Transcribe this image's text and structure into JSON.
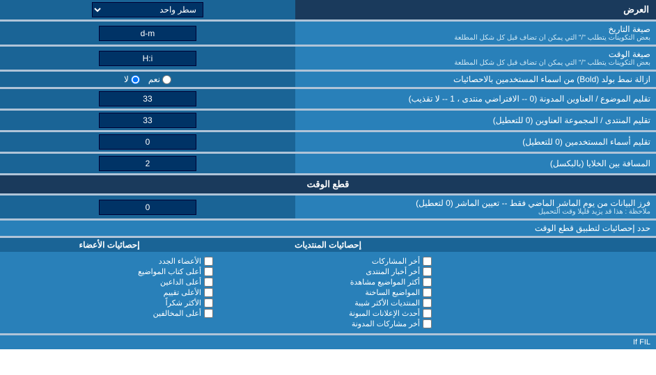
{
  "header": {
    "title": "العرض",
    "single_line_label": "سطر واحد"
  },
  "rows": [
    {
      "label": "صيغة التاريخ",
      "sublabel": "بعض التكوينات يتطلب \"/\" التي يمكن ان تضاف قبل كل شكل المطلعة",
      "input_value": "d-m",
      "type": "text"
    },
    {
      "label": "صيغة الوقت",
      "sublabel": "بعض التكوينات يتطلب \"/\" التي يمكن ان تضاف قبل كل شكل المطلعة",
      "input_value": "H:i",
      "type": "text"
    },
    {
      "label": "ازالة نمط بولد (Bold) من اسماء المستخدمين بالاحصائيات",
      "sublabel": "",
      "radio_yes": "نعم",
      "radio_no": "لا",
      "selected": "no",
      "type": "radio"
    },
    {
      "label": "تقليم الموضوع / العناوين المدونة (0 -- الافتراضي منتدى ، 1 -- لا تقذيب)",
      "sublabel": "",
      "input_value": "33",
      "type": "text"
    },
    {
      "label": "تقليم المنتدى / المجموعة العناوين (0 للتعطيل)",
      "sublabel": "",
      "input_value": "33",
      "type": "text"
    },
    {
      "label": "تقليم أسماء المستخدمين (0 للتعطيل)",
      "sublabel": "",
      "input_value": "0",
      "type": "text"
    },
    {
      "label": "المسافة بين الخلايا (بالبكسل)",
      "sublabel": "",
      "input_value": "2",
      "type": "text"
    }
  ],
  "time_section": {
    "header": "قطع الوقت",
    "row_label": "فرز البيانات من يوم الماشر الماضي فقط -- تعيين الماشر (0 لتعطيل)",
    "row_sublabel": "ملاحظة : هذا قد يزيد قليلا وقت التحميل",
    "row_input": "0"
  },
  "apply_stats": {
    "label": "حدد إحصائيات لتطبيق قطع الوقت"
  },
  "stats_columns": {
    "col1_title": "إحصائيات المنتديات",
    "col1_items": [
      "أخر المشاركات",
      "أخر أخبار المنتدى",
      "أكثر المواضيع مشاهدة",
      "المواضيع الساخنة",
      "المنتديات الأكثر شيبة",
      "أحدث الإعلانات المبونة",
      "أخر مشاركات المدونة"
    ],
    "col2_title": "إحصائيات الأعضاء",
    "col2_items": [
      "الأعضاء الجدد",
      "أعلى كتاب المواضيع",
      "أعلى الداعين",
      "الأعلى تقييم",
      "الأكثر شكراً",
      "أعلى المخالفين"
    ]
  },
  "if_fil_text": "If FIL"
}
